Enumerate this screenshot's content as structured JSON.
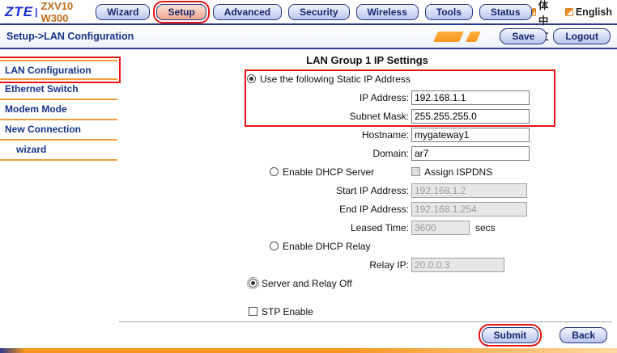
{
  "header": {
    "logo": {
      "brand": "ZTE",
      "separator": "|",
      "model": "ZXV10 W300"
    },
    "tabs": [
      {
        "label": "Wizard"
      },
      {
        "label": "Setup"
      },
      {
        "label": "Advanced"
      },
      {
        "label": "Security"
      },
      {
        "label": "Wireless"
      },
      {
        "label": "Tools"
      },
      {
        "label": "Status"
      }
    ],
    "languages": [
      {
        "label": "简体中文"
      },
      {
        "label": "English"
      }
    ]
  },
  "breadcrumb": {
    "text": "Setup->LAN Configuration"
  },
  "actions": {
    "save": "Save",
    "logout": "Logout"
  },
  "sidebar": {
    "items": [
      {
        "label": "LAN Configuration"
      },
      {
        "label": "Ethernet Switch"
      },
      {
        "label": "Modem Mode"
      },
      {
        "label": "New Connection"
      },
      {
        "label": "wizard"
      }
    ]
  },
  "main": {
    "title": "LAN Group 1 IP Settings",
    "static_ip": {
      "radio_label": "Use the following Static IP Address",
      "ip_label": "IP Address:",
      "ip_value": "192.168.1.1",
      "mask_label": "Subnet Mask:",
      "mask_value": "255.255.255.0"
    },
    "hostname_label": "Hostname:",
    "hostname_value": "mygateway1",
    "domain_label": "Domain:",
    "domain_value": "ar7",
    "dhcp_server": {
      "radio_label": "Enable DHCP Server",
      "ispdns_label": "Assign ISPDNS",
      "start_label": "Start IP Address:",
      "start_value": "192.168.1.2",
      "end_label": "End IP Address:",
      "end_value": "192.168.1.254",
      "lease_label": "Leased Time:",
      "lease_value": "3600",
      "lease_unit": "secs"
    },
    "dhcp_relay": {
      "radio_label": "Enable DHCP Relay",
      "relay_label": "Relay IP:",
      "relay_value": "20.0.0.3"
    },
    "server_relay_off_label": "Server and Relay Off",
    "stp_label": "STP Enable"
  },
  "footer": {
    "submit": "Submit",
    "back": "Back"
  }
}
